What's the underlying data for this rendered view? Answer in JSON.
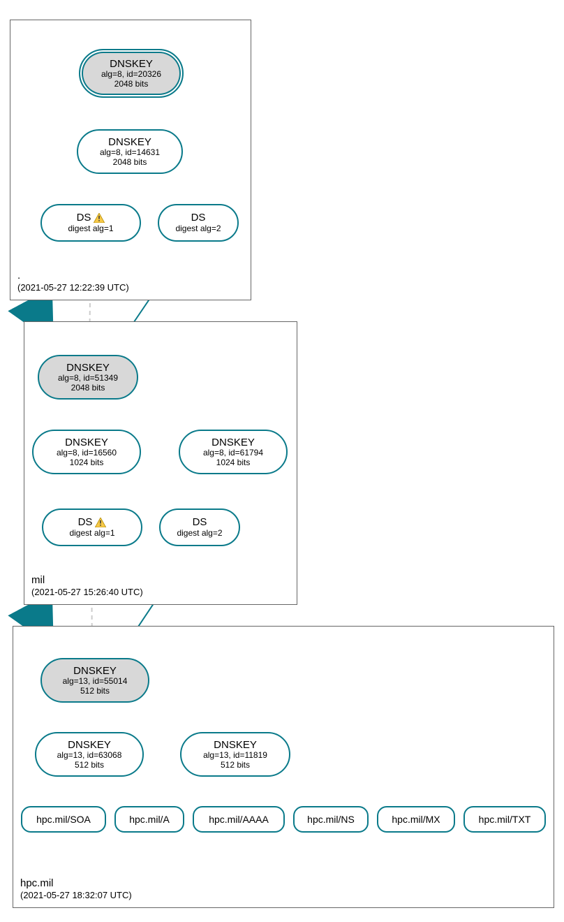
{
  "colors": {
    "teal": "#0a7a8a",
    "nodeFill": "#d8d8d8"
  },
  "zones": {
    "root": {
      "name": ".",
      "timestamp": "(2021-05-27 12:22:39 UTC)"
    },
    "mil": {
      "name": "mil",
      "timestamp": "(2021-05-27 15:26:40 UTC)"
    },
    "hpc": {
      "name": "hpc.mil",
      "timestamp": "(2021-05-27 18:32:07 UTC)"
    }
  },
  "nodes": {
    "root_ksk": {
      "title": "DNSKEY",
      "line2": "alg=8, id=20326",
      "line3": "2048 bits"
    },
    "root_zsk": {
      "title": "DNSKEY",
      "line2": "alg=8, id=14631",
      "line3": "2048 bits"
    },
    "root_ds1": {
      "title": "DS",
      "line2": "digest alg=1",
      "warn": true
    },
    "root_ds2": {
      "title": "DS",
      "line2": "digest alg=2"
    },
    "mil_ksk": {
      "title": "DNSKEY",
      "line2": "alg=8, id=51349",
      "line3": "2048 bits"
    },
    "mil_zsk1": {
      "title": "DNSKEY",
      "line2": "alg=8, id=16560",
      "line3": "1024 bits"
    },
    "mil_zsk2": {
      "title": "DNSKEY",
      "line2": "alg=8, id=61794",
      "line3": "1024 bits"
    },
    "mil_ds1": {
      "title": "DS",
      "line2": "digest alg=1",
      "warn": true
    },
    "mil_ds2": {
      "title": "DS",
      "line2": "digest alg=2"
    },
    "hpc_ksk": {
      "title": "DNSKEY",
      "line2": "alg=13, id=55014",
      "line3": "512 bits"
    },
    "hpc_k2": {
      "title": "DNSKEY",
      "line2": "alg=13, id=63068",
      "line3": "512 bits"
    },
    "hpc_k3": {
      "title": "DNSKEY",
      "line2": "alg=13, id=11819",
      "line3": "512 bits"
    }
  },
  "leaves": {
    "soa": "hpc.mil/SOA",
    "a": "hpc.mil/A",
    "aaaa": "hpc.mil/AAAA",
    "ns": "hpc.mil/NS",
    "mx": "hpc.mil/MX",
    "txt": "hpc.mil/TXT"
  }
}
